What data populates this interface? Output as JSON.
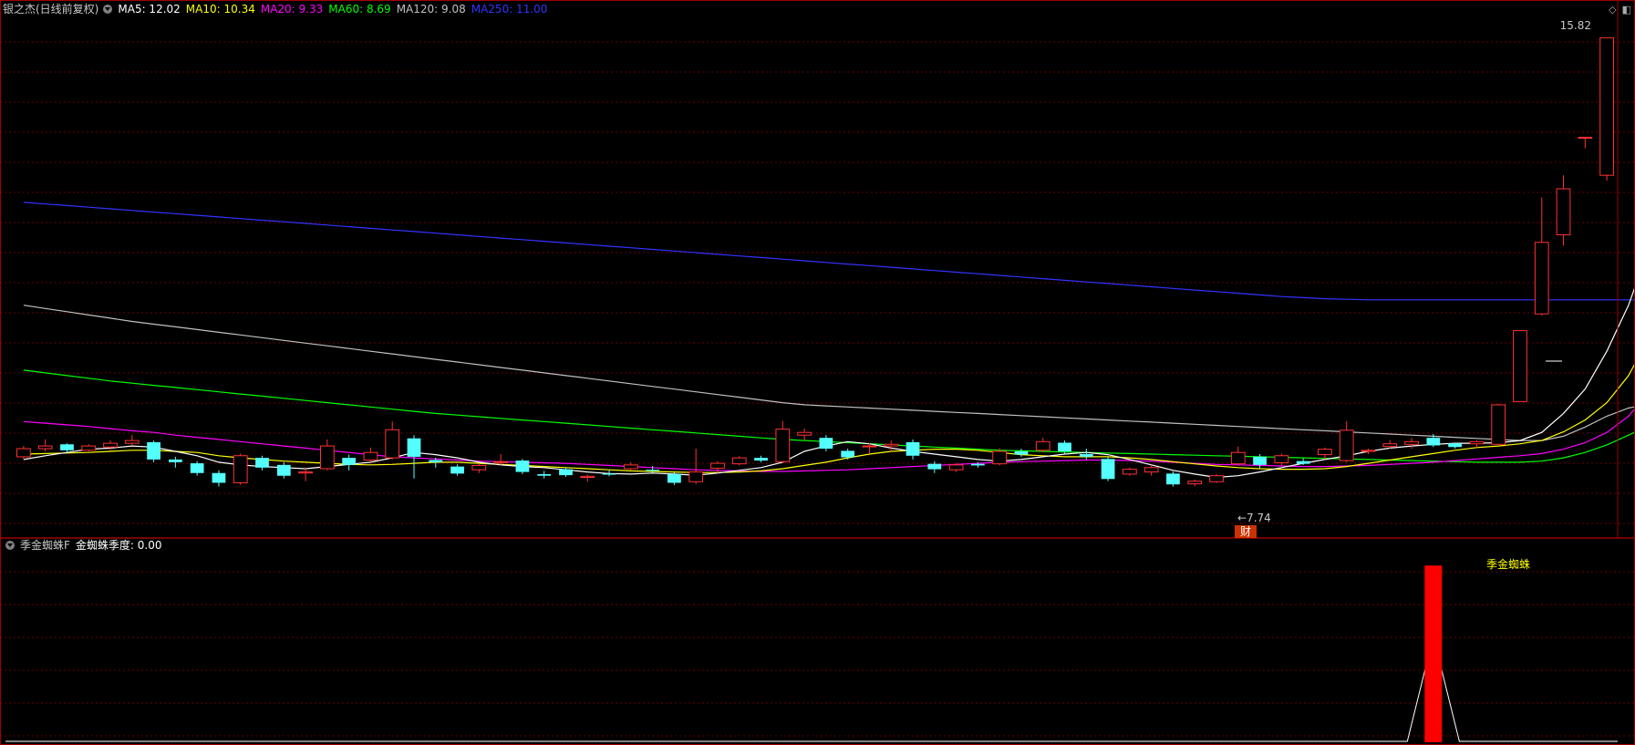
{
  "main_legend": {
    "title": "银之杰(日线前复权)",
    "items": [
      {
        "label": "MA5: 12.02",
        "color": "#ffffff"
      },
      {
        "label": "MA10: 10.34",
        "color": "#ffff00"
      },
      {
        "label": "MA20: 9.33",
        "color": "#ff00ff"
      },
      {
        "label": "MA60: 8.69",
        "color": "#00ff00"
      },
      {
        "label": "MA120: 9.08",
        "color": "#c0c0c0"
      },
      {
        "label": "MA250: 11.00",
        "color": "#3333ff"
      }
    ]
  },
  "sub_legend": {
    "title": "季金蜘蛛F",
    "value_label": "金蜘蛛季度: 0.00"
  },
  "icons": {
    "diamond": "diamond-icon",
    "window": "window-icon"
  },
  "chart_data": [
    {
      "type": "candlestick",
      "ylim": [
        6.6,
        16.2
      ],
      "price_labels": {
        "high": "15.82",
        "low": "←7.74"
      },
      "event_marker": "财",
      "candles": [
        [
          8.1,
          8.25,
          8.05,
          8.3
        ],
        [
          8.25,
          8.3,
          8.2,
          8.42
        ],
        [
          8.33,
          8.22,
          8.18,
          8.35
        ],
        [
          8.22,
          8.3,
          8.2,
          8.33
        ],
        [
          8.28,
          8.35,
          8.22,
          8.4
        ],
        [
          8.35,
          8.4,
          8.3,
          8.5
        ],
        [
          8.37,
          8.05,
          8.0,
          8.4
        ],
        [
          8.05,
          8.0,
          7.9,
          8.1
        ],
        [
          7.98,
          7.8,
          7.75,
          8.02
        ],
        [
          7.8,
          7.62,
          7.55,
          7.85
        ],
        [
          7.62,
          8.12,
          7.58,
          8.16
        ],
        [
          8.08,
          7.9,
          7.85,
          8.12
        ],
        [
          7.95,
          7.75,
          7.7,
          8.0
        ],
        [
          7.8,
          7.82,
          7.65,
          7.9
        ],
        [
          7.88,
          8.3,
          7.85,
          8.42
        ],
        [
          8.08,
          7.95,
          7.85,
          8.14
        ],
        [
          8.04,
          8.18,
          8.0,
          8.27
        ],
        [
          8.08,
          8.6,
          8.05,
          8.75
        ],
        [
          8.44,
          8.1,
          7.7,
          8.5
        ],
        [
          8.04,
          8.0,
          7.9,
          8.08
        ],
        [
          7.92,
          7.79,
          7.75,
          7.96
        ],
        [
          7.86,
          7.94,
          7.8,
          7.98
        ],
        [
          8.01,
          8.01,
          7.95,
          8.15
        ],
        [
          8.03,
          7.82,
          7.78,
          8.06
        ],
        [
          7.78,
          7.75,
          7.7,
          7.84
        ],
        [
          7.87,
          7.76,
          7.73,
          7.9
        ],
        [
          7.72,
          7.74,
          7.64,
          7.77
        ],
        [
          7.79,
          7.77,
          7.74,
          7.85
        ],
        [
          7.88,
          7.95,
          7.85,
          8.0
        ],
        [
          7.86,
          7.84,
          7.8,
          7.93
        ],
        [
          7.78,
          7.62,
          7.58,
          7.82
        ],
        [
          7.64,
          7.82,
          7.6,
          8.25
        ],
        [
          7.89,
          7.98,
          7.8,
          8.02
        ],
        [
          7.97,
          8.08,
          7.94,
          8.11
        ],
        [
          8.08,
          8.03,
          8.0,
          8.12
        ],
        [
          8.01,
          8.61,
          7.98,
          8.76
        ],
        [
          8.5,
          8.55,
          8.4,
          8.62
        ],
        [
          8.45,
          8.25,
          8.2,
          8.5
        ],
        [
          8.21,
          8.09,
          8.05,
          8.25
        ],
        [
          8.29,
          8.3,
          8.15,
          8.35
        ],
        [
          8.3,
          8.33,
          8.2,
          8.4
        ],
        [
          8.37,
          8.12,
          8.05,
          8.42
        ],
        [
          7.97,
          7.87,
          7.8,
          8.02
        ],
        [
          7.86,
          7.95,
          7.82,
          7.98
        ],
        [
          7.97,
          7.94,
          7.9,
          8.0
        ],
        [
          7.97,
          8.2,
          7.94,
          8.26
        ],
        [
          8.2,
          8.14,
          8.1,
          8.25
        ],
        [
          8.22,
          8.38,
          8.18,
          8.45
        ],
        [
          8.36,
          8.2,
          8.15,
          8.4
        ],
        [
          8.15,
          8.1,
          8.05,
          8.25
        ],
        [
          8.06,
          7.69,
          7.65,
          8.1
        ],
        [
          7.78,
          7.87,
          7.75,
          7.9
        ],
        [
          7.82,
          7.9,
          7.75,
          7.95
        ],
        [
          7.79,
          7.59,
          7.55,
          7.83
        ],
        [
          7.6,
          7.65,
          7.56,
          7.68
        ],
        [
          7.64,
          7.75,
          7.62,
          7.78
        ],
        [
          7.97,
          8.18,
          7.94,
          8.29
        ],
        [
          8.1,
          7.95,
          7.88,
          8.15
        ],
        [
          7.99,
          8.12,
          7.94,
          8.16
        ],
        [
          8.02,
          7.97,
          7.95,
          8.07
        ],
        [
          8.14,
          8.24,
          8.05,
          8.27
        ],
        [
          8.03,
          8.59,
          8.0,
          8.76
        ],
        [
          8.2,
          8.22,
          8.15,
          8.25
        ],
        [
          8.29,
          8.34,
          8.25,
          8.41
        ],
        [
          8.33,
          8.38,
          8.25,
          8.45
        ],
        [
          8.45,
          8.31,
          8.28,
          8.52
        ],
        [
          8.35,
          8.28,
          8.25,
          8.36
        ],
        [
          8.34,
          8.38,
          8.27,
          8.4
        ],
        [
          8.33,
          9.06,
          8.32,
          9.08
        ],
        [
          9.12,
          10.43,
          9.12,
          10.43
        ],
        [
          10.74,
          12.06,
          10.71,
          12.89
        ],
        [
          12.2,
          13.05,
          12.0,
          13.3
        ],
        [
          14.0,
          14.0,
          13.8,
          14.0
        ],
        [
          13.3,
          15.84,
          13.2,
          15.84
        ]
      ],
      "ma5": [
        8.05,
        8.12,
        8.18,
        8.24,
        8.26,
        8.3,
        8.28,
        8.2,
        8.12,
        8.0,
        7.95,
        7.92,
        7.9,
        7.88,
        7.92,
        7.96,
        8.0,
        8.08,
        8.18,
        8.14,
        8.08,
        8.0,
        7.95,
        7.92,
        7.9,
        7.86,
        7.82,
        7.79,
        7.78,
        7.8,
        7.78,
        7.76,
        7.8,
        7.85,
        7.9,
        8.0,
        8.2,
        8.3,
        8.38,
        8.34,
        8.26,
        8.2,
        8.15,
        8.1,
        8.05,
        8.02,
        8.05,
        8.1,
        8.15,
        8.18,
        8.14,
        8.05,
        7.95,
        7.85,
        7.78,
        7.72,
        7.75,
        7.82,
        7.9,
        7.98,
        8.05,
        8.12,
        8.2,
        8.26,
        8.3,
        8.33,
        8.35,
        8.35,
        8.36,
        8.4,
        8.55,
        8.9,
        9.35,
        10.05,
        10.9,
        12.02
      ],
      "ma10": [
        8.15,
        8.16,
        8.17,
        8.18,
        8.2,
        8.22,
        8.22,
        8.2,
        8.18,
        8.12,
        8.08,
        8.05,
        8.02,
        8.0,
        7.98,
        7.96,
        7.95,
        7.96,
        7.98,
        8.0,
        8.0,
        7.98,
        7.96,
        7.94,
        7.92,
        7.9,
        7.88,
        7.86,
        7.84,
        7.83,
        7.82,
        7.81,
        7.81,
        7.82,
        7.84,
        7.88,
        7.94,
        8.0,
        8.08,
        8.15,
        8.2,
        8.22,
        8.24,
        8.24,
        8.22,
        8.18,
        8.14,
        8.12,
        8.1,
        8.1,
        8.1,
        8.08,
        8.05,
        8.01,
        7.97,
        7.93,
        7.9,
        7.88,
        7.87,
        7.87,
        7.88,
        7.92,
        7.98,
        8.04,
        8.1,
        8.16,
        8.22,
        8.27,
        8.3,
        8.34,
        8.4,
        8.56,
        8.78,
        9.1,
        9.6,
        10.34
      ],
      "ma20": [
        8.75,
        8.72,
        8.69,
        8.66,
        8.62,
        8.58,
        8.55,
        8.5,
        8.46,
        8.42,
        8.38,
        8.34,
        8.3,
        8.26,
        8.22,
        8.18,
        8.14,
        8.1,
        8.08,
        8.06,
        8.04,
        8.02,
        8.01,
        8.0,
        7.99,
        7.98,
        7.96,
        7.94,
        7.92,
        7.9,
        7.88,
        7.86,
        7.85,
        7.84,
        7.83,
        7.83,
        7.84,
        7.85,
        7.86,
        7.88,
        7.9,
        7.92,
        7.94,
        7.96,
        7.98,
        8.0,
        8.01,
        8.02,
        8.03,
        8.04,
        8.04,
        8.03,
        8.02,
        8.0,
        7.98,
        7.96,
        7.95,
        7.94,
        7.93,
        7.92,
        7.92,
        7.93,
        7.94,
        7.96,
        7.98,
        8.0,
        8.03,
        8.06,
        8.09,
        8.12,
        8.16,
        8.24,
        8.36,
        8.55,
        8.85,
        9.33
      ],
      "ma60": [
        9.7,
        9.65,
        9.6,
        9.55,
        9.5,
        9.46,
        9.42,
        9.38,
        9.34,
        9.3,
        9.26,
        9.22,
        9.18,
        9.14,
        9.1,
        9.06,
        9.02,
        8.98,
        8.94,
        8.9,
        8.87,
        8.84,
        8.81,
        8.78,
        8.75,
        8.72,
        8.69,
        8.66,
        8.63,
        8.6,
        8.57,
        8.54,
        8.51,
        8.48,
        8.45,
        8.42,
        8.4,
        8.38,
        8.36,
        8.34,
        8.32,
        8.3,
        8.28,
        8.26,
        8.24,
        8.22,
        8.21,
        8.2,
        8.19,
        8.18,
        8.17,
        8.16,
        8.15,
        8.14,
        8.13,
        8.12,
        8.11,
        8.1,
        8.09,
        8.08,
        8.07,
        8.06,
        8.05,
        8.04,
        8.03,
        8.02,
        8.01,
        8.0,
        8.0,
        8.0,
        8.02,
        8.08,
        8.18,
        8.32,
        8.5,
        8.69
      ],
      "ma120": [
        10.9,
        10.84,
        10.78,
        10.72,
        10.66,
        10.6,
        10.55,
        10.5,
        10.45,
        10.4,
        10.35,
        10.3,
        10.25,
        10.2,
        10.15,
        10.1,
        10.05,
        10.0,
        9.95,
        9.9,
        9.85,
        9.8,
        9.75,
        9.7,
        9.65,
        9.6,
        9.55,
        9.5,
        9.45,
        9.4,
        9.35,
        9.3,
        9.25,
        9.2,
        9.15,
        9.1,
        9.06,
        9.04,
        9.02,
        9.0,
        8.98,
        8.96,
        8.94,
        8.92,
        8.9,
        8.88,
        8.86,
        8.84,
        8.82,
        8.8,
        8.78,
        8.76,
        8.74,
        8.72,
        8.7,
        8.68,
        8.66,
        8.64,
        8.62,
        8.6,
        8.58,
        8.56,
        8.54,
        8.52,
        8.5,
        8.48,
        8.46,
        8.44,
        8.42,
        8.4,
        8.4,
        8.48,
        8.65,
        8.85,
        9.0,
        9.08
      ],
      "ma250": [
        12.8,
        12.77,
        12.74,
        12.71,
        12.68,
        12.65,
        12.62,
        12.59,
        12.56,
        12.53,
        12.5,
        12.47,
        12.44,
        12.41,
        12.38,
        12.35,
        12.32,
        12.29,
        12.26,
        12.23,
        12.2,
        12.17,
        12.14,
        12.11,
        12.08,
        12.05,
        12.02,
        11.99,
        11.96,
        11.93,
        11.9,
        11.87,
        11.84,
        11.81,
        11.78,
        11.75,
        11.72,
        11.69,
        11.66,
        11.63,
        11.6,
        11.57,
        11.54,
        11.51,
        11.48,
        11.45,
        11.42,
        11.39,
        11.36,
        11.33,
        11.3,
        11.27,
        11.24,
        11.21,
        11.18,
        11.15,
        11.12,
        11.09,
        11.06,
        11.04,
        11.02,
        11.01,
        11.0,
        11.0,
        11.0,
        11.0,
        11.0,
        11.0,
        11.0,
        11.0,
        11.0,
        11.0,
        11.0,
        11.0,
        11.0,
        11.0
      ]
    },
    {
      "type": "bar",
      "series_label": "季金蜘蛛",
      "ylim": [
        0,
        100
      ],
      "signal_index": 65,
      "signal_value": 95
    }
  ]
}
